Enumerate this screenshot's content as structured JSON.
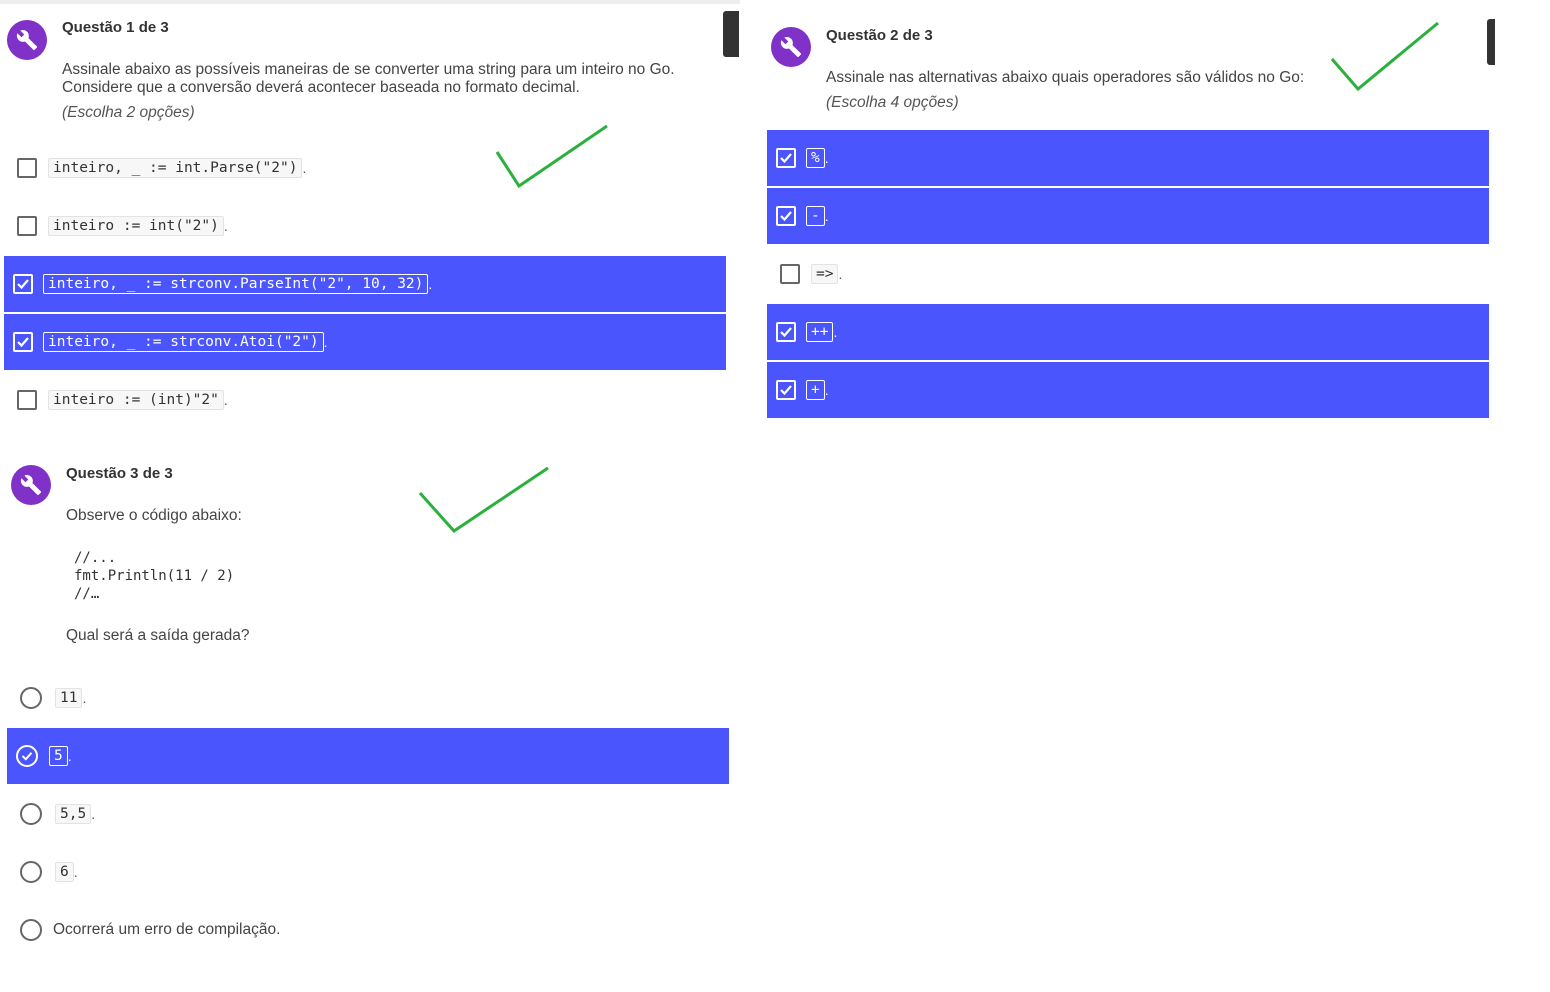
{
  "colors": {
    "accent": "#4b55fd",
    "avatar": "#8031c8",
    "annotation_check": "#2bb03e"
  },
  "icons": {
    "avatar": "wrench-icon",
    "annotation": "green-checkmark-icon"
  },
  "question1": {
    "title": "Questão 1 de 3",
    "text_line1": "Assinale abaixo as possíveis maneiras de se converter uma string para um inteiro no Go.",
    "text_line2": "Considere que a conversão deverá acontecer baseada no formato decimal.",
    "hint": "(Escolha 2 opções)",
    "options": [
      {
        "code": "inteiro, _ := int.Parse(\"2\")",
        "suffix": ".",
        "checked": false
      },
      {
        "code": "inteiro := int(\"2\")",
        "suffix": ".",
        "checked": false
      },
      {
        "code": "inteiro, _ := strconv.ParseInt(\"2\", 10, 32)",
        "suffix": ".",
        "checked": true
      },
      {
        "code": "inteiro, _ := strconv.Atoi(\"2\")",
        "suffix": ".",
        "checked": true
      },
      {
        "code": "inteiro := (int)\"2\"",
        "suffix": ".",
        "checked": false
      }
    ]
  },
  "question2": {
    "title": "Questão 2 de 3",
    "text": "Assinale nas alternativas abaixo quais operadores são válidos no Go:",
    "hint": "(Escolha 4 opções)",
    "options": [
      {
        "code": "%",
        "suffix": ".",
        "checked": true
      },
      {
        "code": "-",
        "suffix": ".",
        "checked": true
      },
      {
        "code": "=>",
        "suffix": ".",
        "checked": false
      },
      {
        "code": "++",
        "suffix": ".",
        "checked": true
      },
      {
        "code": "+",
        "suffix": ".",
        "checked": true
      }
    ]
  },
  "question3": {
    "title": "Questão 3 de 3",
    "intro": "Observe o código abaixo:",
    "code_lines": [
      "//...",
      "fmt.Println(11 / 2)",
      "//…"
    ],
    "question": "Qual será a saída gerada?",
    "options": [
      {
        "code": "11",
        "suffix": ".",
        "selected": false
      },
      {
        "code": "5",
        "suffix": ".",
        "selected": true
      },
      {
        "code": "5,5",
        "suffix": ".",
        "selected": false
      },
      {
        "code": "6",
        "suffix": ".",
        "selected": false
      },
      {
        "label": "Ocorrerá um erro de compilação.",
        "selected": false
      }
    ]
  }
}
